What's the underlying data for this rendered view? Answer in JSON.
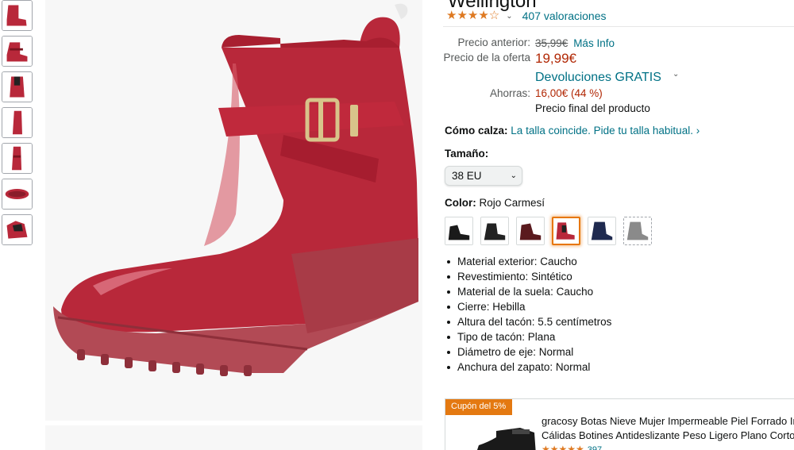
{
  "product": {
    "title": "Wellington",
    "rating_stars": "★★★★☆",
    "ratings_count": "407 valoraciones"
  },
  "pricing": {
    "previous_label": "Precio anterior:",
    "previous_price": "35,99€",
    "more_info": "Más Info",
    "offer_label": "Precio de la oferta",
    "offer_price": "19,99€",
    "returns": "Devoluciones GRATIS",
    "savings_label": "Ahorras:",
    "savings_value": "16,00€ (44 %)",
    "final_price_note": "Precio final del producto"
  },
  "fit": {
    "label": "Cómo calza:",
    "text": "La talla coincide. Pide tu talla habitual. ›"
  },
  "size": {
    "label": "Tamaño:",
    "selected": "38 EU"
  },
  "color": {
    "label": "Color:",
    "selected": "Rojo Carmesí",
    "swatches": [
      {
        "color": "#1a1a1a"
      },
      {
        "color": "#222222"
      },
      {
        "color": "#5a1a1e"
      },
      {
        "color": "#b8283a"
      },
      {
        "color": "#1f2a4f"
      },
      {
        "color": "#8a8a8a"
      }
    ]
  },
  "features": [
    "Material exterior: Caucho",
    "Revestimiento: Sintético",
    "Material de la suela: Caucho",
    "Cierre: Hebilla",
    "Altura del tacón: 5.5 centímetros",
    "Tipo de tacón: Plana",
    "Diámetro de eje: Normal",
    "Anchura del zapato: Normal"
  ],
  "sponsored": {
    "coupon": "Cupón del 5%",
    "title_line1": "gracosy Botas Nieve Mujer Impermeable Piel Forrado Invierno",
    "title_line2": "Cálidas Botines Antideslizante Peso Ligero Plano Corto Botas",
    "stars": "★★★★★",
    "count": "397"
  },
  "colors": {
    "link": "#007185",
    "price": "#b12704",
    "star": "#de7921",
    "coupon_bg": "#e47911",
    "boot_red": "#b8283a"
  }
}
